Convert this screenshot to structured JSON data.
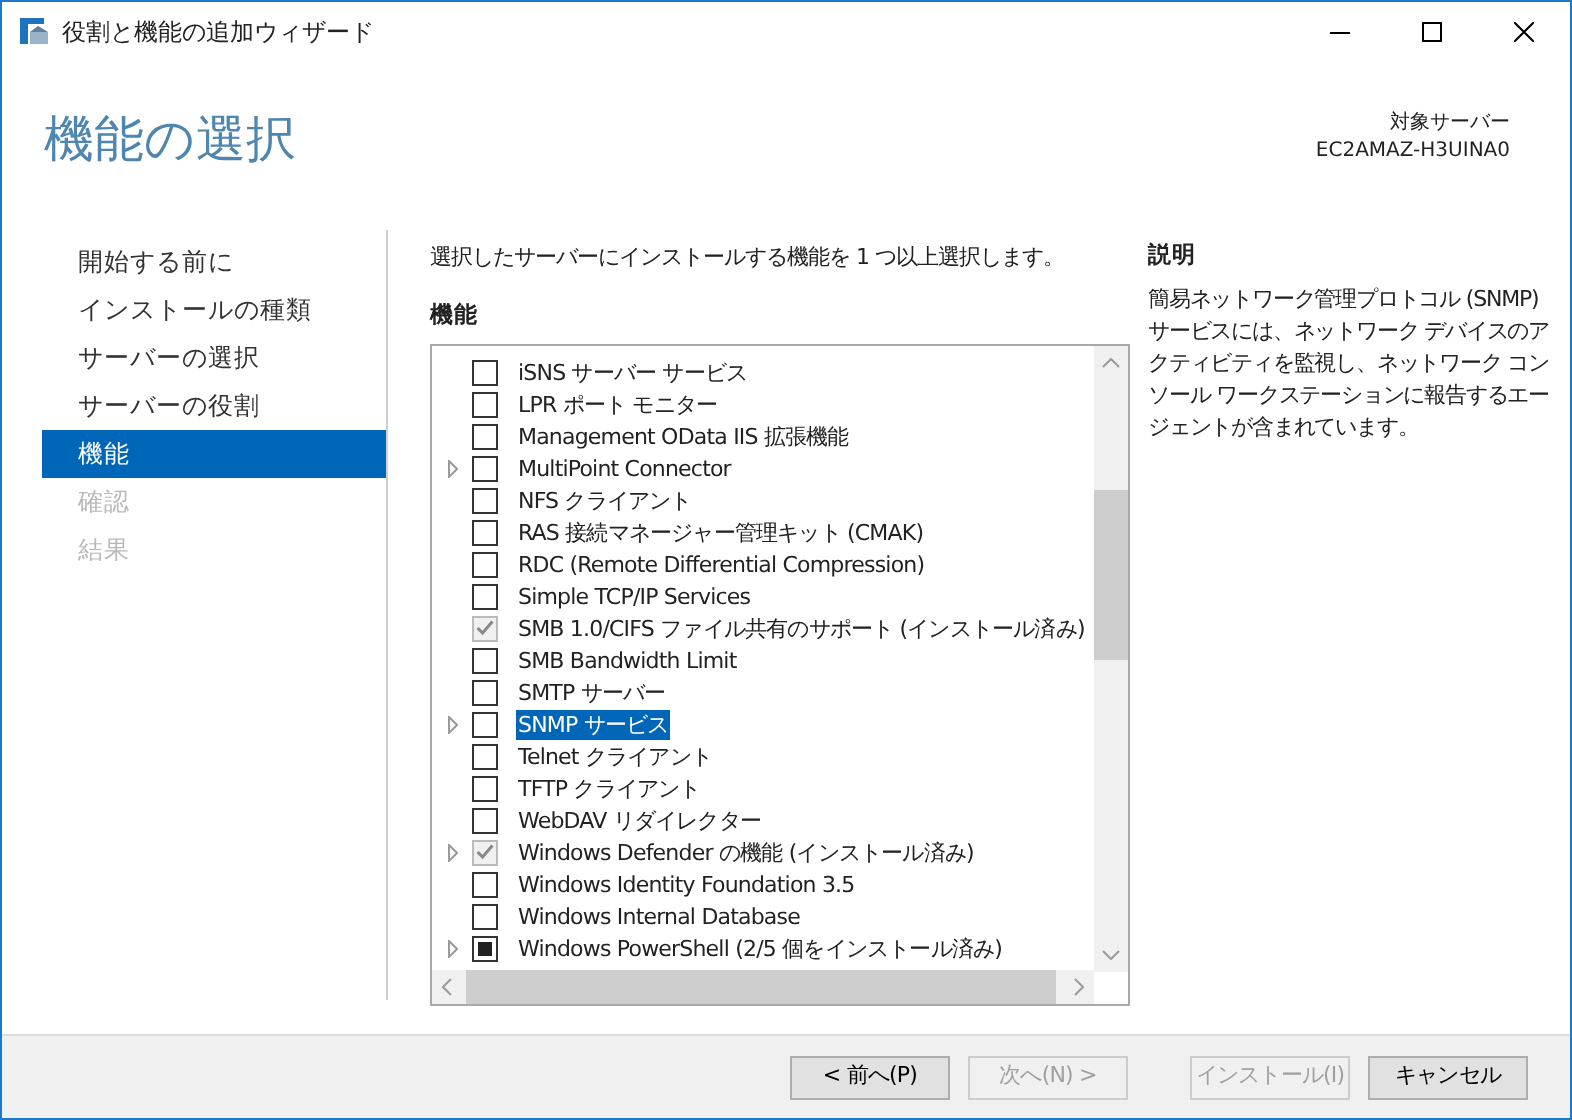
{
  "window": {
    "title": "役割と機能の追加ウィザード"
  },
  "header": {
    "title": "機能の選択",
    "target_label": "対象サーバー",
    "target_server": "EC2AMAZ-H3UINA0"
  },
  "sidebar": {
    "items": [
      {
        "label": "開始する前に",
        "selected": false,
        "disabled": false
      },
      {
        "label": "インストールの種類",
        "selected": false,
        "disabled": false
      },
      {
        "label": "サーバーの選択",
        "selected": false,
        "disabled": false
      },
      {
        "label": "サーバーの役割",
        "selected": false,
        "disabled": false
      },
      {
        "label": "機能",
        "selected": true,
        "disabled": false
      },
      {
        "label": "確認",
        "selected": false,
        "disabled": true
      },
      {
        "label": "結果",
        "selected": false,
        "disabled": true
      }
    ]
  },
  "instruction": "選択したサーバーにインストールする機能を 1 つ以上選択します。",
  "features": {
    "heading": "機能",
    "items": [
      {
        "label": "iSNS サーバー サービス",
        "expandable": false,
        "checked": false,
        "disabled": false,
        "selected": false
      },
      {
        "label": "LPR ポート モニター",
        "expandable": false,
        "checked": false,
        "disabled": false,
        "selected": false
      },
      {
        "label": "Management OData IIS 拡張機能",
        "expandable": false,
        "checked": false,
        "disabled": false,
        "selected": false
      },
      {
        "label": "MultiPoint Connector",
        "expandable": true,
        "checked": false,
        "disabled": false,
        "selected": false
      },
      {
        "label": "NFS クライアント",
        "expandable": false,
        "checked": false,
        "disabled": false,
        "selected": false
      },
      {
        "label": "RAS 接続マネージャー管理キット (CMAK)",
        "expandable": false,
        "checked": false,
        "disabled": false,
        "selected": false
      },
      {
        "label": "RDC (Remote Differential Compression)",
        "expandable": false,
        "checked": false,
        "disabled": false,
        "selected": false
      },
      {
        "label": "Simple TCP/IP Services",
        "expandable": false,
        "checked": false,
        "disabled": false,
        "selected": false
      },
      {
        "label": "SMB 1.0/CIFS ファイル共有のサポート (インストール済み)",
        "expandable": false,
        "checked": true,
        "disabled": true,
        "selected": false
      },
      {
        "label": "SMB Bandwidth Limit",
        "expandable": false,
        "checked": false,
        "disabled": false,
        "selected": false
      },
      {
        "label": "SMTP サーバー",
        "expandable": false,
        "checked": false,
        "disabled": false,
        "selected": false
      },
      {
        "label": "SNMP サービス",
        "expandable": true,
        "checked": false,
        "disabled": false,
        "selected": true
      },
      {
        "label": "Telnet クライアント",
        "expandable": false,
        "checked": false,
        "disabled": false,
        "selected": false
      },
      {
        "label": "TFTP クライアント",
        "expandable": false,
        "checked": false,
        "disabled": false,
        "selected": false
      },
      {
        "label": "WebDAV リダイレクター",
        "expandable": false,
        "checked": false,
        "disabled": false,
        "selected": false
      },
      {
        "label": "Windows Defender の機能 (インストール済み)",
        "expandable": true,
        "checked": true,
        "disabled": true,
        "selected": false
      },
      {
        "label": "Windows Identity Foundation 3.5",
        "expandable": false,
        "checked": false,
        "disabled": false,
        "selected": false
      },
      {
        "label": "Windows Internal Database",
        "expandable": false,
        "checked": false,
        "disabled": false,
        "selected": false
      },
      {
        "label": "Windows PowerShell (2/5 個をインストール済み)",
        "expandable": true,
        "checked": false,
        "partial": true,
        "disabled": false,
        "selected": false
      }
    ]
  },
  "description": {
    "heading": "説明",
    "text": "簡易ネットワーク管理プロトコル (SNMP) サービスには、ネットワーク デバイスのアクティビティを監視し、ネットワーク コンソール ワークステーションに報告するエージェントが含まれています。"
  },
  "buttons": [
    {
      "label": "< 前へ(P)",
      "disabled": false
    },
    {
      "label": "次へ(N) >",
      "disabled": true
    },
    {
      "label": "インストール(I)",
      "disabled": true
    },
    {
      "label": "キャンセル",
      "disabled": false
    }
  ]
}
